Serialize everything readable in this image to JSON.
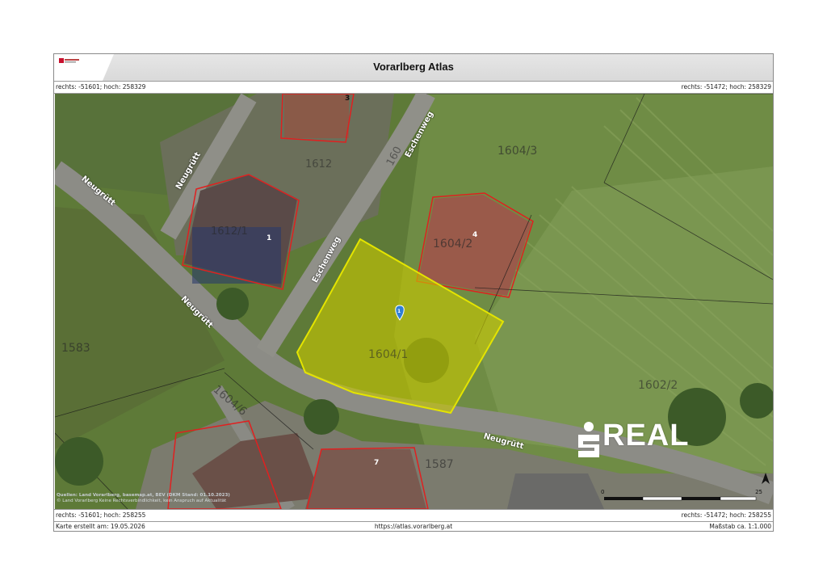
{
  "header": {
    "title": "Vorarlberg Atlas"
  },
  "coords": {
    "top_left": "rechts: -51601; hoch: 258329",
    "top_right": "rechts: -51472; hoch: 258329",
    "bottom_left": "rechts: -51601; hoch: 258255",
    "bottom_right": "rechts: -51472; hoch: 258255"
  },
  "footer": {
    "created": "Karte erstellt am: 19.05.2026",
    "url": "https://atlas.vorarlberg.at",
    "scale_text": "Maßstab ca. 1:1.000"
  },
  "map": {
    "streets": [
      "Neugrütt",
      "Neugrütt",
      "Neugrütt",
      "Neugrütt",
      "Eschenweg",
      "Eschenweg"
    ],
    "parcels": [
      "1604/3",
      "1604/2",
      "1612/1",
      "1612",
      "160",
      "1583",
      "1604/1",
      "1604/6",
      "1602/2",
      "1587"
    ],
    "house_numbers": [
      "3",
      "1",
      "4",
      "7"
    ],
    "marker_label": "1",
    "attribution": [
      "Quellen: Land Vorarlberg, basemap.at, BEV (DKM Stand: 01.10.2023)",
      "© Land Vorarlberg Keine Rechtsverbindlichkeit, kein Anspruch auf Aktualität"
    ],
    "scale_start": "0",
    "scale_end": "25"
  },
  "overlay": {
    "brand": "REAL"
  },
  "colors": {
    "highlight_fill": "#c8c800",
    "highlight_stroke": "#e4e400",
    "parcel_red": "#e02020",
    "marker_blue": "#2f7fd6"
  }
}
